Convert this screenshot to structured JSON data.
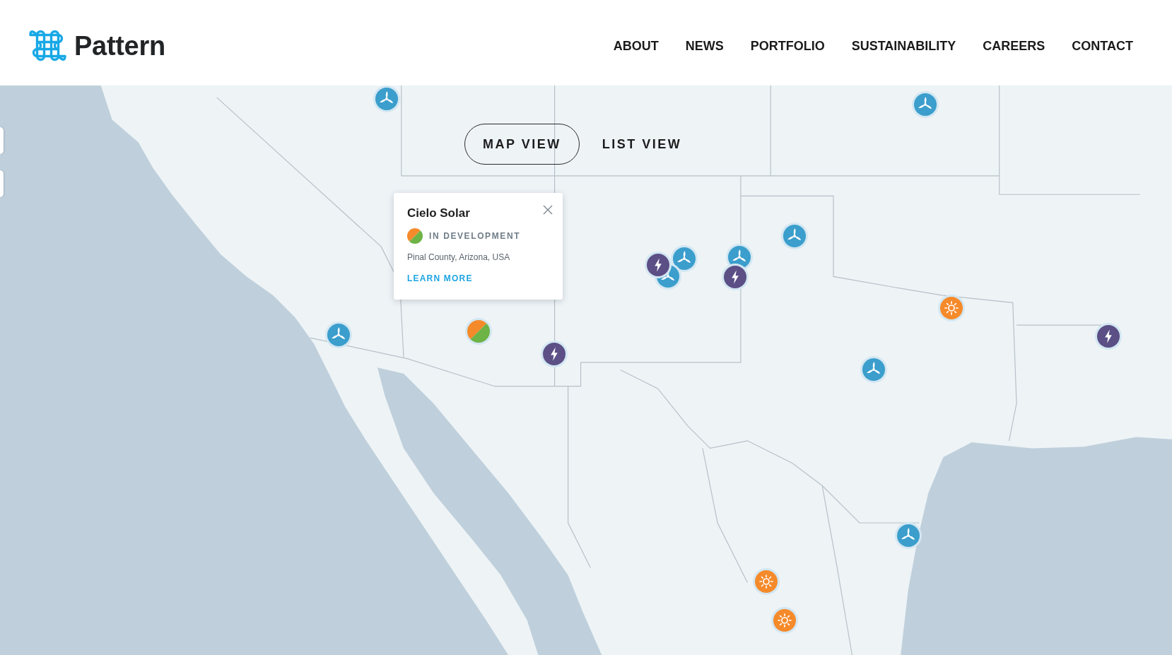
{
  "header": {
    "logo": {
      "text": "Pattern"
    },
    "nav": [
      "ABOUT",
      "NEWS",
      "PORTFOLIO",
      "SUSTAINABILITY",
      "CAREERS",
      "CONTACT"
    ]
  },
  "map": {
    "view_tabs": [
      {
        "label": "MAP VIEW",
        "selected": true
      },
      {
        "label": "LIST VIEW",
        "selected": false
      }
    ],
    "markers": [
      {
        "kind": "wind"
      },
      {
        "kind": "wind"
      },
      {
        "kind": "wind"
      },
      {
        "kind": "wind"
      },
      {
        "kind": "wind"
      },
      {
        "kind": "bolt"
      },
      {
        "kind": "wind"
      },
      {
        "kind": "bolt"
      },
      {
        "kind": "solar"
      },
      {
        "kind": "bolt"
      },
      {
        "kind": "wind"
      },
      {
        "kind": "development"
      },
      {
        "kind": "bolt"
      },
      {
        "kind": "wind"
      },
      {
        "kind": "wind"
      },
      {
        "kind": "solar"
      },
      {
        "kind": "solar"
      }
    ],
    "popup": {
      "title": "Cielo Solar",
      "status": "IN DEVELOPMENT",
      "location": "Pinal County, Arizona, USA",
      "link": "LEARN MORE"
    }
  }
}
